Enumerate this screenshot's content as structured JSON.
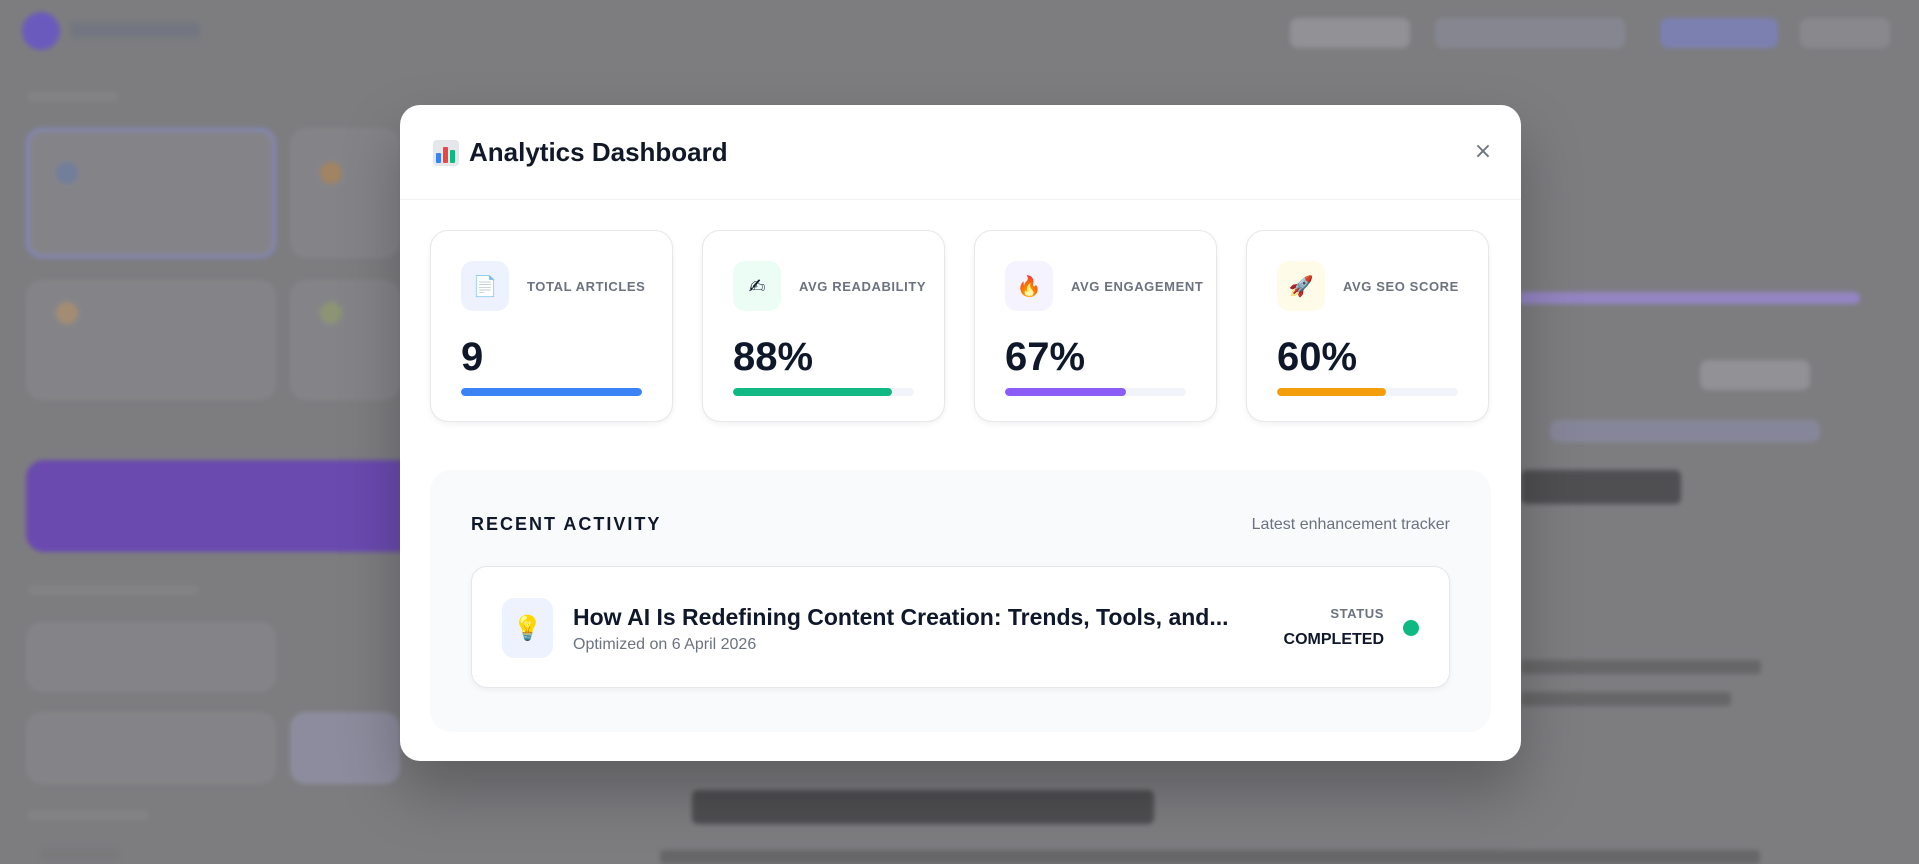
{
  "modal": {
    "title": "Analytics Dashboard",
    "title_icon": "bar-chart-icon",
    "close_label": "×"
  },
  "stats": [
    {
      "label": "TOTAL ARTICLES",
      "value": "9",
      "icon": "document-icon",
      "icon_glyph": "📄",
      "icon_bg": "#eef2ff",
      "bar_color": "#3b82f6",
      "fill_fraction": 1.0
    },
    {
      "label": "AVG READABILITY",
      "value": "88%",
      "icon": "writing-hand-icon",
      "icon_glyph": "✍",
      "icon_bg": "#ecfdf5",
      "bar_color": "#10b981",
      "fill_fraction": 0.88
    },
    {
      "label": "AVG ENGAGEMENT",
      "value": "67%",
      "icon": "fire-icon",
      "icon_glyph": "🔥",
      "icon_bg": "#f5f3ff",
      "bar_color": "#8b5cf6",
      "fill_fraction": 0.67
    },
    {
      "label": "AVG SEO SCORE",
      "value": "60%",
      "icon": "rocket-icon",
      "icon_glyph": "🚀",
      "icon_bg": "#fefce8",
      "bar_color": "#f59e0b",
      "fill_fraction": 0.6
    }
  ],
  "activity": {
    "title": "RECENT ACTIVITY",
    "subtitle": "Latest enhancement tracker",
    "items": [
      {
        "icon": "lightbulb-icon",
        "icon_glyph": "💡",
        "title": "How AI Is Redefining Content Creation: Trends, Tools, and...",
        "date": "Optimized on 6 April 2026",
        "status_label": "STATUS",
        "status_value": "COMPLETED",
        "status_color": "#10b981"
      }
    ]
  }
}
